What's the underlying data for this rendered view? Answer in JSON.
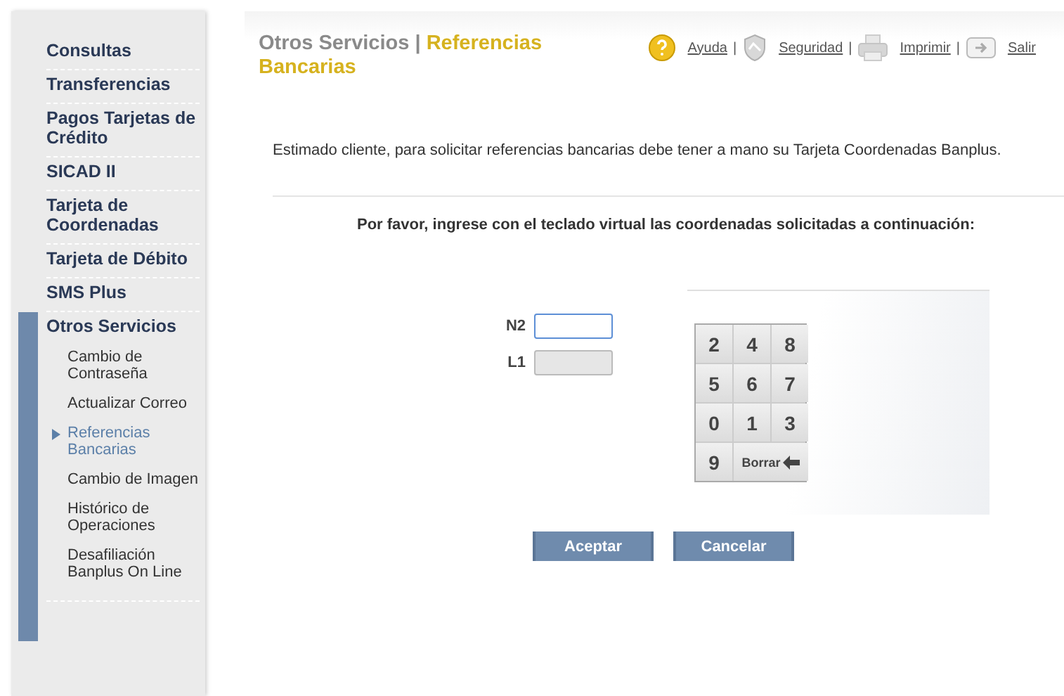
{
  "sidebar": {
    "items": [
      {
        "label": "Consultas",
        "expanded": false
      },
      {
        "label": "Transferencias",
        "expanded": false
      },
      {
        "label": "Pagos Tarjetas de Crédito",
        "expanded": false
      },
      {
        "label": "SICAD II",
        "expanded": false
      },
      {
        "label": "Tarjeta de Coordenadas",
        "expanded": false
      },
      {
        "label": "Tarjeta de Débito",
        "expanded": false
      },
      {
        "label": "SMS Plus",
        "expanded": false
      },
      {
        "label": "Otros Servicios",
        "expanded": true,
        "children": [
          {
            "label": "Cambio de Contraseña",
            "selected": false
          },
          {
            "label": "Actualizar Correo",
            "selected": false
          },
          {
            "label": "Referencias Bancarias",
            "selected": true
          },
          {
            "label": "Cambio de Imagen",
            "selected": false
          },
          {
            "label": "Histórico de Operaciones",
            "selected": false
          },
          {
            "label": "Desafiliación Banplus On Line",
            "selected": false
          }
        ]
      }
    ]
  },
  "header": {
    "section": "Otros Servicios",
    "separator": "|",
    "page": "Referencias Bancarias",
    "links": [
      {
        "kind": "help",
        "label": "Ayuda",
        "separator": "|"
      },
      {
        "kind": "security",
        "label": "Seguridad",
        "separator": "|"
      },
      {
        "kind": "print",
        "label": "Imprimir",
        "separator": "|"
      },
      {
        "kind": "exit",
        "label": "Salir"
      }
    ]
  },
  "intro": "Estimado cliente, para solicitar referencias bancarias debe tener a mano su Tarjeta Coordenadas Banplus.",
  "instruction": "Por favor, ingrese con el teclado virtual las coordenadas solicitadas a continuación:",
  "fields": [
    {
      "label": "N2",
      "focused": true,
      "disabled": false
    },
    {
      "label": "L1",
      "focused": false,
      "disabled": true
    }
  ],
  "keypad": [
    {
      "kind": "digit",
      "label": "2"
    },
    {
      "kind": "digit",
      "label": "4"
    },
    {
      "kind": "digit",
      "label": "8"
    },
    {
      "kind": "digit",
      "label": "5"
    },
    {
      "kind": "digit",
      "label": "6"
    },
    {
      "kind": "digit",
      "label": "7"
    },
    {
      "kind": "digit",
      "label": "0"
    },
    {
      "kind": "digit",
      "label": "1"
    },
    {
      "kind": "digit",
      "label": "3"
    },
    {
      "kind": "digit",
      "label": "9"
    },
    {
      "kind": "backspace",
      "label": "Borrar"
    }
  ],
  "buttons": [
    "Aceptar",
    "Cancelar"
  ]
}
